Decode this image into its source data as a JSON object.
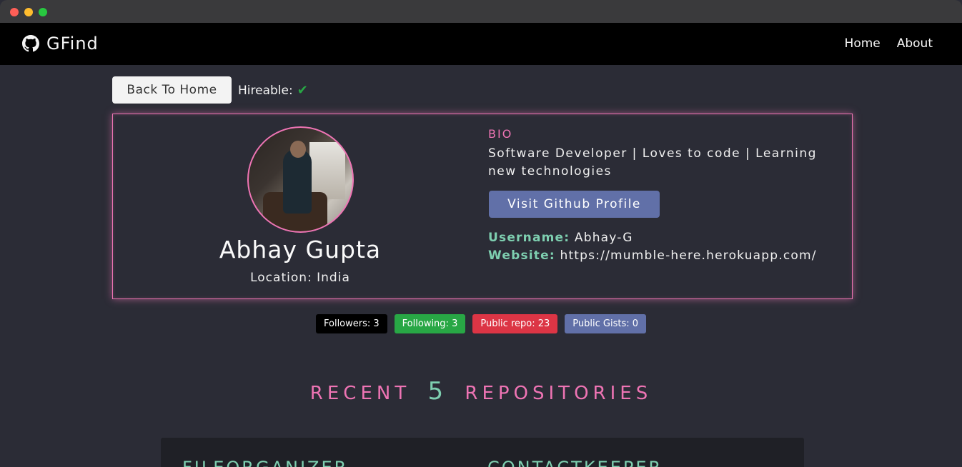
{
  "window": {
    "title": "GFind"
  },
  "navbar": {
    "brand": "GFind",
    "brand_icon": "github-icon",
    "links": [
      {
        "label": "Home"
      },
      {
        "label": "About"
      }
    ]
  },
  "actions": {
    "back_label": "Back To Home",
    "hireable_label": "Hireable:",
    "hireable_icon": "check-icon"
  },
  "profile": {
    "name": "Abhay Gupta",
    "location": "Location: India",
    "bio_heading": "BIO",
    "bio": "Software Developer | Loves to code | Learning new technologies",
    "github_button": "Visit Github Profile",
    "username_label": "Username:",
    "username": "Abhay-G",
    "website_label": "Website:",
    "website": "https://mumble-here.herokuapp.com/"
  },
  "badges": [
    {
      "label": "Followers: 3",
      "color": "#000000"
    },
    {
      "label": "Following: 3",
      "color": "#28a745"
    },
    {
      "label": "Public repo: 23",
      "color": "#dc3545"
    },
    {
      "label": "Public Gists: 0",
      "color": "#6170a8"
    }
  ],
  "section": {
    "title_pre": "RECENT",
    "count": "5",
    "title_post": "REPOSITORIES"
  },
  "repos": [
    {
      "name": "FILEORGANIZER"
    },
    {
      "name": "CONTACTKEEPER"
    }
  ],
  "colors": {
    "accent_pink": "#ee74b4",
    "accent_teal": "#7ecfb0",
    "background": "#2b2c36"
  }
}
